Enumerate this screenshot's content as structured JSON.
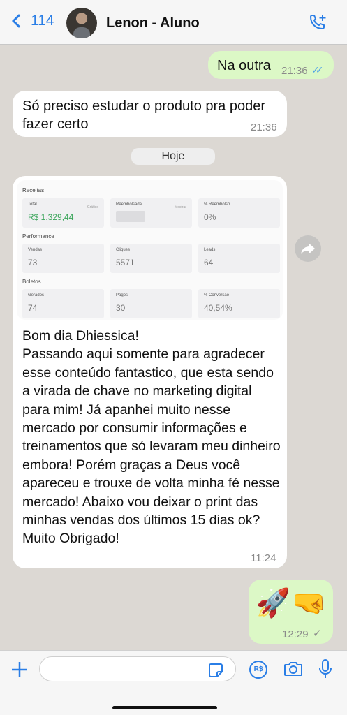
{
  "header": {
    "back_count": "114",
    "contact_name": "Lenon - Aluno"
  },
  "messages": [
    {
      "text": "Na outra",
      "time": "21:36"
    },
    {
      "text": "Só preciso estudar o produto pra poder fazer certo",
      "time": "21:36"
    }
  ],
  "date_separator": "Hoje",
  "screenshot": {
    "sections": [
      "Receitas",
      "Performance",
      "Boletos"
    ],
    "cards": [
      {
        "label": "Total",
        "value": "R$ 1.329,44",
        "side": "Gráfico"
      },
      {
        "label": "Reembolsada",
        "value": "",
        "side": "Mostrar"
      },
      {
        "label": "% Reembolso",
        "value": "0%"
      },
      {
        "label": "Vendas",
        "value": "73"
      },
      {
        "label": "Cliques",
        "value": "5571"
      },
      {
        "label": "Leads",
        "value": "64"
      },
      {
        "label": "Gerados",
        "value": "74"
      },
      {
        "label": "Pagos",
        "value": "30"
      },
      {
        "label": "% Conversão",
        "value": "40,54%"
      }
    ],
    "accent": "#3aa55a"
  },
  "long_message": {
    "text": "Bom dia Dhiessica!\nPassando aqui somente para agradecer esse conteúdo fantastico, que esta sendo a virada de chave no marketing digital para mim! Já apanhei muito nesse mercado por consumir informações e treinamentos que só levaram meu dinheiro embora! Porém graças a Deus você apareceu e trouxe de volta minha fé nesse mercado! Abaixo vou deixar o print das minhas vendas dos últimos 15 dias ok? Muito Obrigado!",
    "time": "11:24"
  },
  "emoji_message": {
    "emoji1": "🚀",
    "emoji2": "🤜",
    "time": "12:29"
  },
  "composer": {
    "pay_label": "R$"
  },
  "colors": {
    "accent": "#2a7ee6",
    "outgoing": "#dcf8c6",
    "incoming": "#ffffff"
  }
}
